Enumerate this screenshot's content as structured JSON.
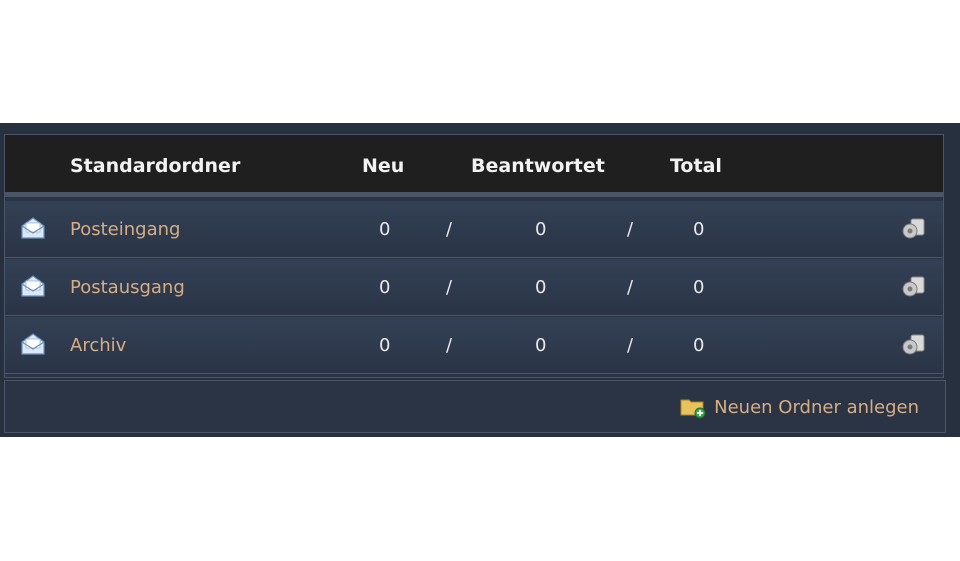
{
  "table": {
    "headers": {
      "folder": "Standardordner",
      "new": "Neu",
      "answered": "Beantwortet",
      "total": "Total"
    },
    "separator": "/",
    "rows": [
      {
        "name": "Posteingang",
        "new": "0",
        "answered": "0",
        "total": "0"
      },
      {
        "name": "Postausgang",
        "new": "0",
        "answered": "0",
        "total": "0"
      },
      {
        "name": "Archiv",
        "new": "0",
        "answered": "0",
        "total": "0"
      }
    ]
  },
  "footer": {
    "new_folder_label": "Neuen Ordner anlegen"
  },
  "icons": {
    "row": "envelope-icon",
    "action": "settings-icon",
    "footer": "folder-add-icon"
  },
  "colors": {
    "panel_bg": "#27303f",
    "header_bg": "#1f1f1f",
    "link": "#d7ae84",
    "text": "#e8e8e8"
  }
}
